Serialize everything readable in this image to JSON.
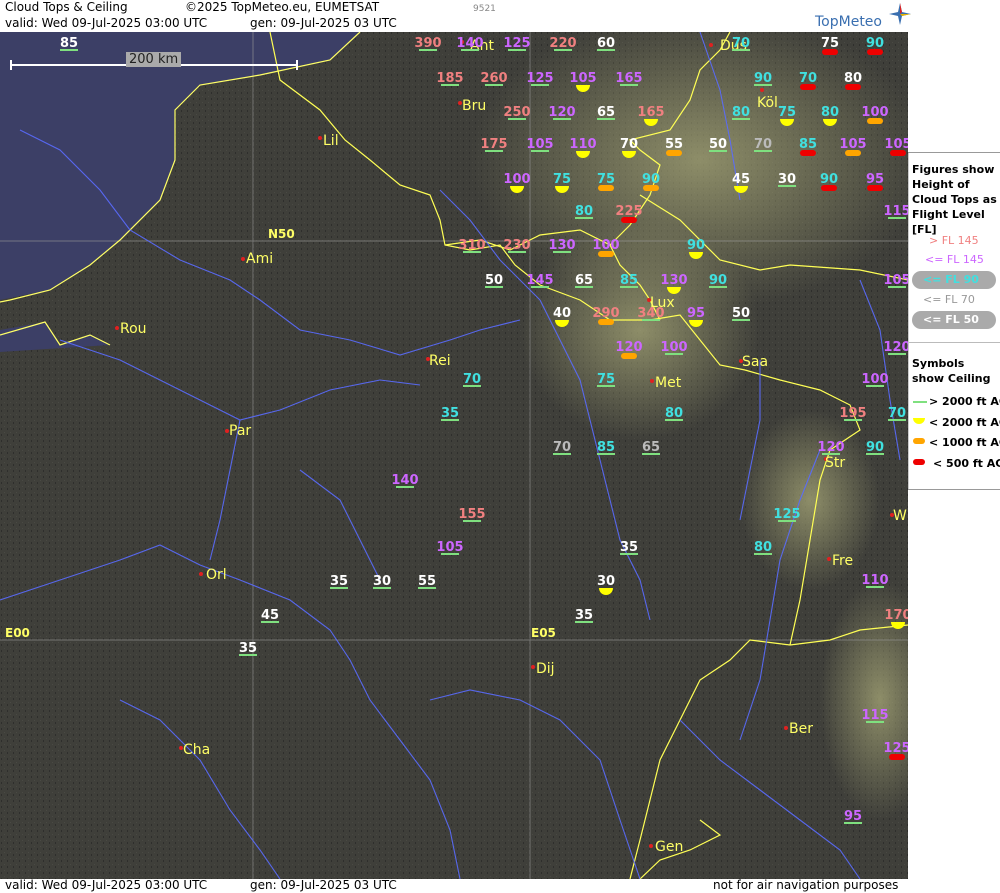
{
  "header": {
    "title": "Cloud Tops & Ceiling",
    "copyright": "©2025 TopMeteo.eu, EUMETSAT",
    "valid": "valid:  Wed  09-Jul-2025  03:00 UTC",
    "gen": "gen: 09-Jul-2025 03 UTC",
    "code": "9521",
    "brand": "TopMeteo"
  },
  "footer": {
    "valid": "valid:  Wed  09-Jul-2025  03:00 UTC",
    "gen": "gen: 09-Jul-2025 03 UTC",
    "disclaimer": "not for air navigation purposes"
  },
  "scale": {
    "label": "200 km"
  },
  "legend": {
    "figures_title": "Figures show Height of Cloud Tops as Flight Level [FL]",
    "figures": [
      {
        "label": "> FL 145",
        "color": "#f08080"
      },
      {
        "label": "<= FL 145",
        "color": "#cc66ff"
      },
      {
        "label": "<= FL 90",
        "color": "#40e0e0"
      },
      {
        "label": "<= FL 70",
        "color": "#bbbbbb"
      },
      {
        "label": "<= FL 50",
        "color": "#ffffff"
      }
    ],
    "symbols_title": "Symbols show Ceiling",
    "symbols": [
      {
        "label": "> 2000 ft AGL",
        "color": "#7fe07f"
      },
      {
        "label": "< 2000 ft AGL",
        "color": "#ffff00"
      },
      {
        "label": "< 1000 ft AGL",
        "color": "#ffa500"
      },
      {
        "label": "< 500 ft AGL",
        "color": "#ee0000"
      }
    ]
  },
  "map": {
    "coord_labels": [
      "N50",
      "E00",
      "E05"
    ],
    "cities": [
      "Ant",
      "Dus",
      "Köl",
      "Bru",
      "Lil",
      "Ami",
      "Rou",
      "Rei",
      "Par",
      "Lux",
      "Saa",
      "Met",
      "Str",
      "Fre",
      "Orl",
      "Dij",
      "Ber",
      "Cha",
      "Gen",
      "W"
    ],
    "values": [
      "390",
      "140",
      "125",
      "220",
      "60",
      "185",
      "260",
      "125",
      "105",
      "165",
      "250",
      "120",
      "65",
      "165",
      "175",
      "105",
      "110",
      "70",
      "55",
      "50",
      "70",
      "85",
      "105",
      "105",
      "100",
      "75",
      "75",
      "90",
      "45",
      "30",
      "90",
      "95",
      "115",
      "80",
      "225",
      "310",
      "230",
      "130",
      "100",
      "90",
      "50",
      "145",
      "65",
      "85",
      "130",
      "90",
      "105",
      "40",
      "290",
      "340",
      "95",
      "50",
      "120",
      "100",
      "120",
      "75",
      "70",
      "35",
      "80",
      "100",
      "195",
      "70",
      "85",
      "65",
      "70",
      "120",
      "90",
      "140",
      "155",
      "125",
      "105",
      "35",
      "80",
      "110",
      "35",
      "30",
      "55",
      "30",
      "35",
      "45",
      "35",
      "170",
      "115",
      "125",
      "95",
      "85",
      "70",
      "75",
      "90",
      "90",
      "70",
      "80",
      "80",
      "75",
      "80",
      "100"
    ]
  }
}
